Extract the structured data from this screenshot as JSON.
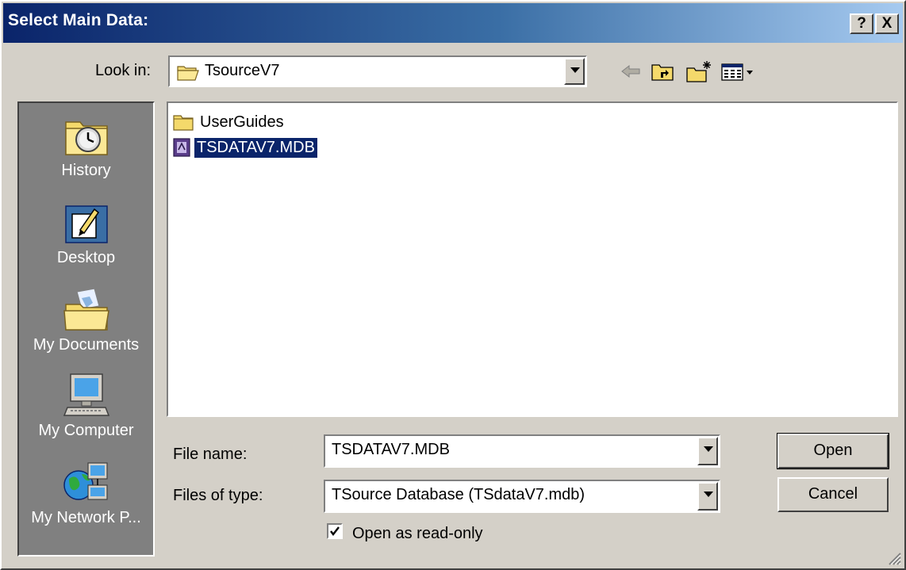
{
  "window": {
    "title": "Select Main Data:",
    "help_label": "?",
    "close_label": "X"
  },
  "look_in": {
    "label": "Look in:",
    "value": "TsourceV7"
  },
  "places": [
    {
      "label": "History",
      "icon": "history-icon"
    },
    {
      "label": "Desktop",
      "icon": "desktop-icon"
    },
    {
      "label": "My Documents",
      "icon": "my-documents-icon"
    },
    {
      "label": "My Computer",
      "icon": "my-computer-icon"
    },
    {
      "label": "My Network P...",
      "icon": "my-network-places-icon"
    }
  ],
  "files": [
    {
      "name": "UserGuides",
      "type": "folder",
      "selected": false
    },
    {
      "name": "TSDATAV7.MDB",
      "type": "mdb",
      "selected": true
    }
  ],
  "file_name": {
    "label": "File name:",
    "value": "TSDATAV7.MDB"
  },
  "file_type": {
    "label": "Files of type:",
    "value": "TSource Database (TSdataV7.mdb)"
  },
  "read_only": {
    "label": "Open as read-only",
    "checked": true
  },
  "buttons": {
    "open": "Open",
    "cancel": "Cancel"
  },
  "colors": {
    "title_start": "#0a246a",
    "title_end": "#a6caf0",
    "face": "#d4d0c8",
    "places_bg": "#808080",
    "selection": "#0a246a"
  }
}
